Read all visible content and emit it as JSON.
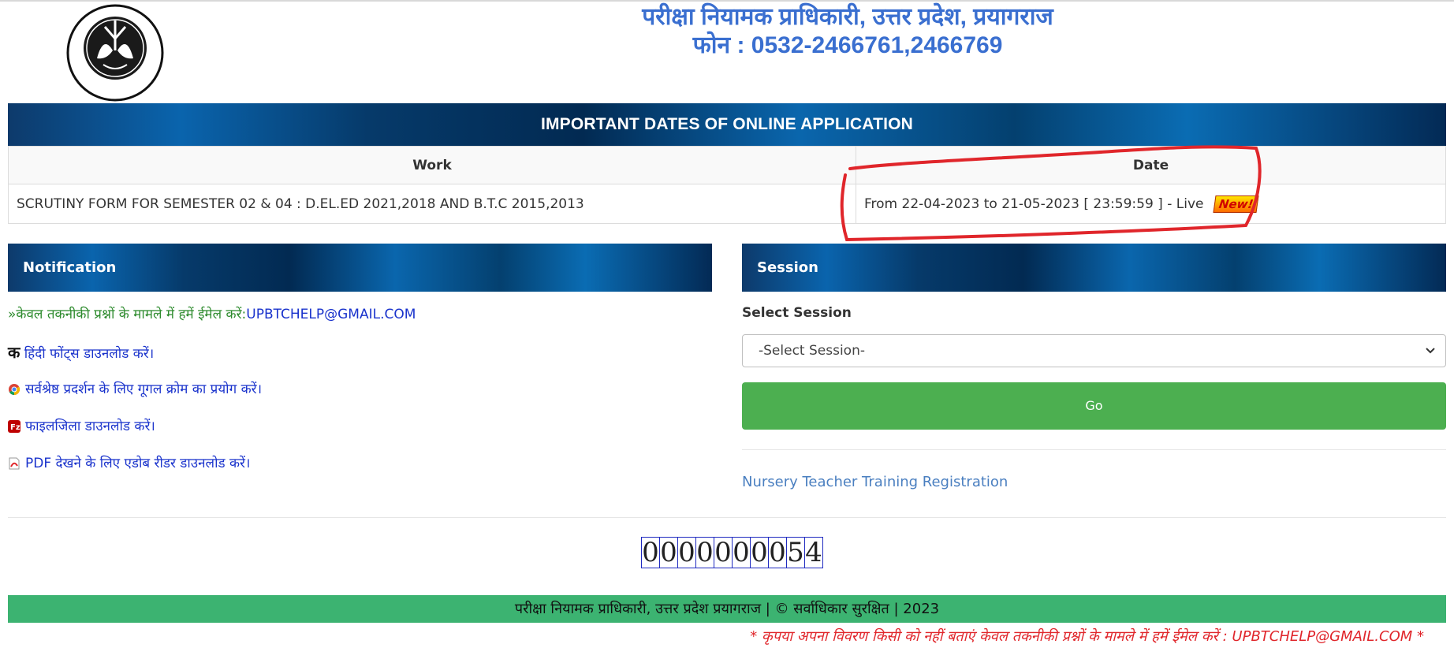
{
  "header": {
    "title": "परीक्षा नियामक प्राधिकारी, उत्तर प्रदेश, प्रयागराज",
    "phone": "फोन : 0532-2466761,2466769",
    "logo_text": "परीक्षा नियामक प्राधिकारी उत्तर प्रदेश"
  },
  "important_dates": {
    "heading": "IMPORTANT DATES OF ONLINE APPLICATION",
    "columns": [
      "Work",
      "Date"
    ],
    "rows": [
      {
        "work": "SCRUTINY FORM FOR SEMESTER 02 & 04 : D.EL.ED 2021,2018 AND B.T.C 2015,2013",
        "date": "From 22-04-2023 to 21-05-2023 [ 23:59:59 ] - Live",
        "badge": "New!"
      }
    ]
  },
  "notification": {
    "heading": "Notification",
    "items": [
      {
        "text": "»केवल तकनीकी प्रश्नों के मामले में हमें ईमेल करें:",
        "link": "UPBTCHELP@GMAIL.COM",
        "icon": "arrow"
      },
      {
        "icon_char": "क",
        "text": "हिंदी फोंट्स डाउनलोड करें।",
        "icon": "hindi-font-icon"
      },
      {
        "text": "सर्वश्रेष्ठ प्रदर्शन के लिए गूगल क्रोम का प्रयोग करें।",
        "icon": "chrome-icon"
      },
      {
        "text": "फाइलजिला डाउनलोड करें।",
        "icon": "filezilla-icon"
      },
      {
        "text": "PDF देखने के लिए एडोब रीडर डाउनलोड करें।",
        "icon": "pdf-icon"
      }
    ]
  },
  "session": {
    "heading": "Session",
    "label": "Select Session",
    "select_value": "-Select Session-",
    "go_label": "Go",
    "link": "Nursery Teacher Training Registration"
  },
  "counter": {
    "digits": [
      "0",
      "0",
      "0",
      "0",
      "0",
      "0",
      "0",
      "0",
      "5",
      "4"
    ]
  },
  "footer": {
    "text": "परीक्षा नियामक प्राधिकारी, उत्तर प्रदेश प्रयागराज | © सर्वाधिकार सुरक्षित | 2023",
    "disclaimer": "* कृपया अपना विवरण किसी को नहीं बताएं  केवल तकनीकी प्रश्नों के मामले में हमें ईमेल करें : UPBTCHELP@GMAIL.COM *"
  },
  "colors": {
    "title_blue": "#3a6fd0",
    "go_green": "#4caf50",
    "footer_green": "#3cb371",
    "annotation_red": "#e0262b"
  }
}
